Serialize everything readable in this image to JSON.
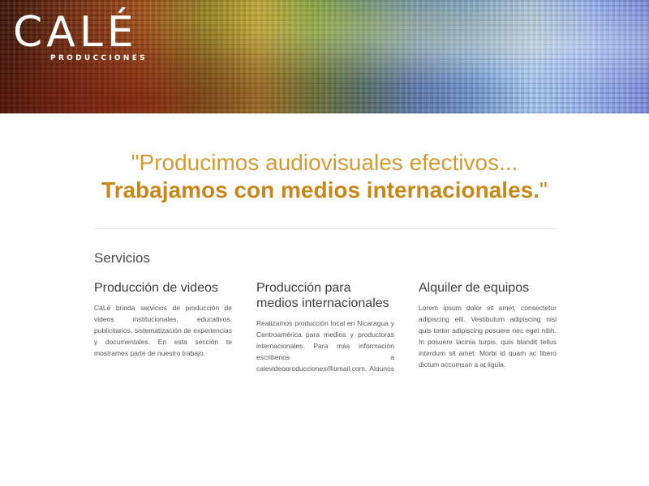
{
  "brand": {
    "name": "CALÉ",
    "tagline": "PRODUCCIONES"
  },
  "quote": {
    "line1": "\"Producimos audiovisuales efectivos...",
    "line2": "Trabajamos con medios internacionales.",
    "line2_close": "\""
  },
  "services": {
    "title": "Servicios",
    "items": [
      {
        "heading": "Producción de videos",
        "body": "CaLé brinda servicios de producción de videos institucionales, educativos, publicitarios, sistematización de experiencias y documentales. En esta sección te mostramos parte de nuestro trabajo."
      },
      {
        "heading": "Producción para medios internacionales",
        "body": "Realizamos producción local en Nicaragua y Centroamérica para medios y productoras internacionales. Para más información escribenos a calevideoproducciones@gmail.com. Algunos de nuestros clientes son RBC, News"
      },
      {
        "heading": "Alquiler de equipos",
        "body": "Lorem ipsum dolor sit amet, consectetur adipiscing elit. Vestibulum adipiscing nisl quis tortor adipiscing posuere nec eget nibh. In posuere lacinia turpis, quis blandit tellus interdum sit amet. Morbi id quam ac libero dictum accumsan a at ligula."
      }
    ]
  },
  "colors": {
    "accent": "#c9861a",
    "heading": "#3d3d3d",
    "text": "#555555"
  }
}
